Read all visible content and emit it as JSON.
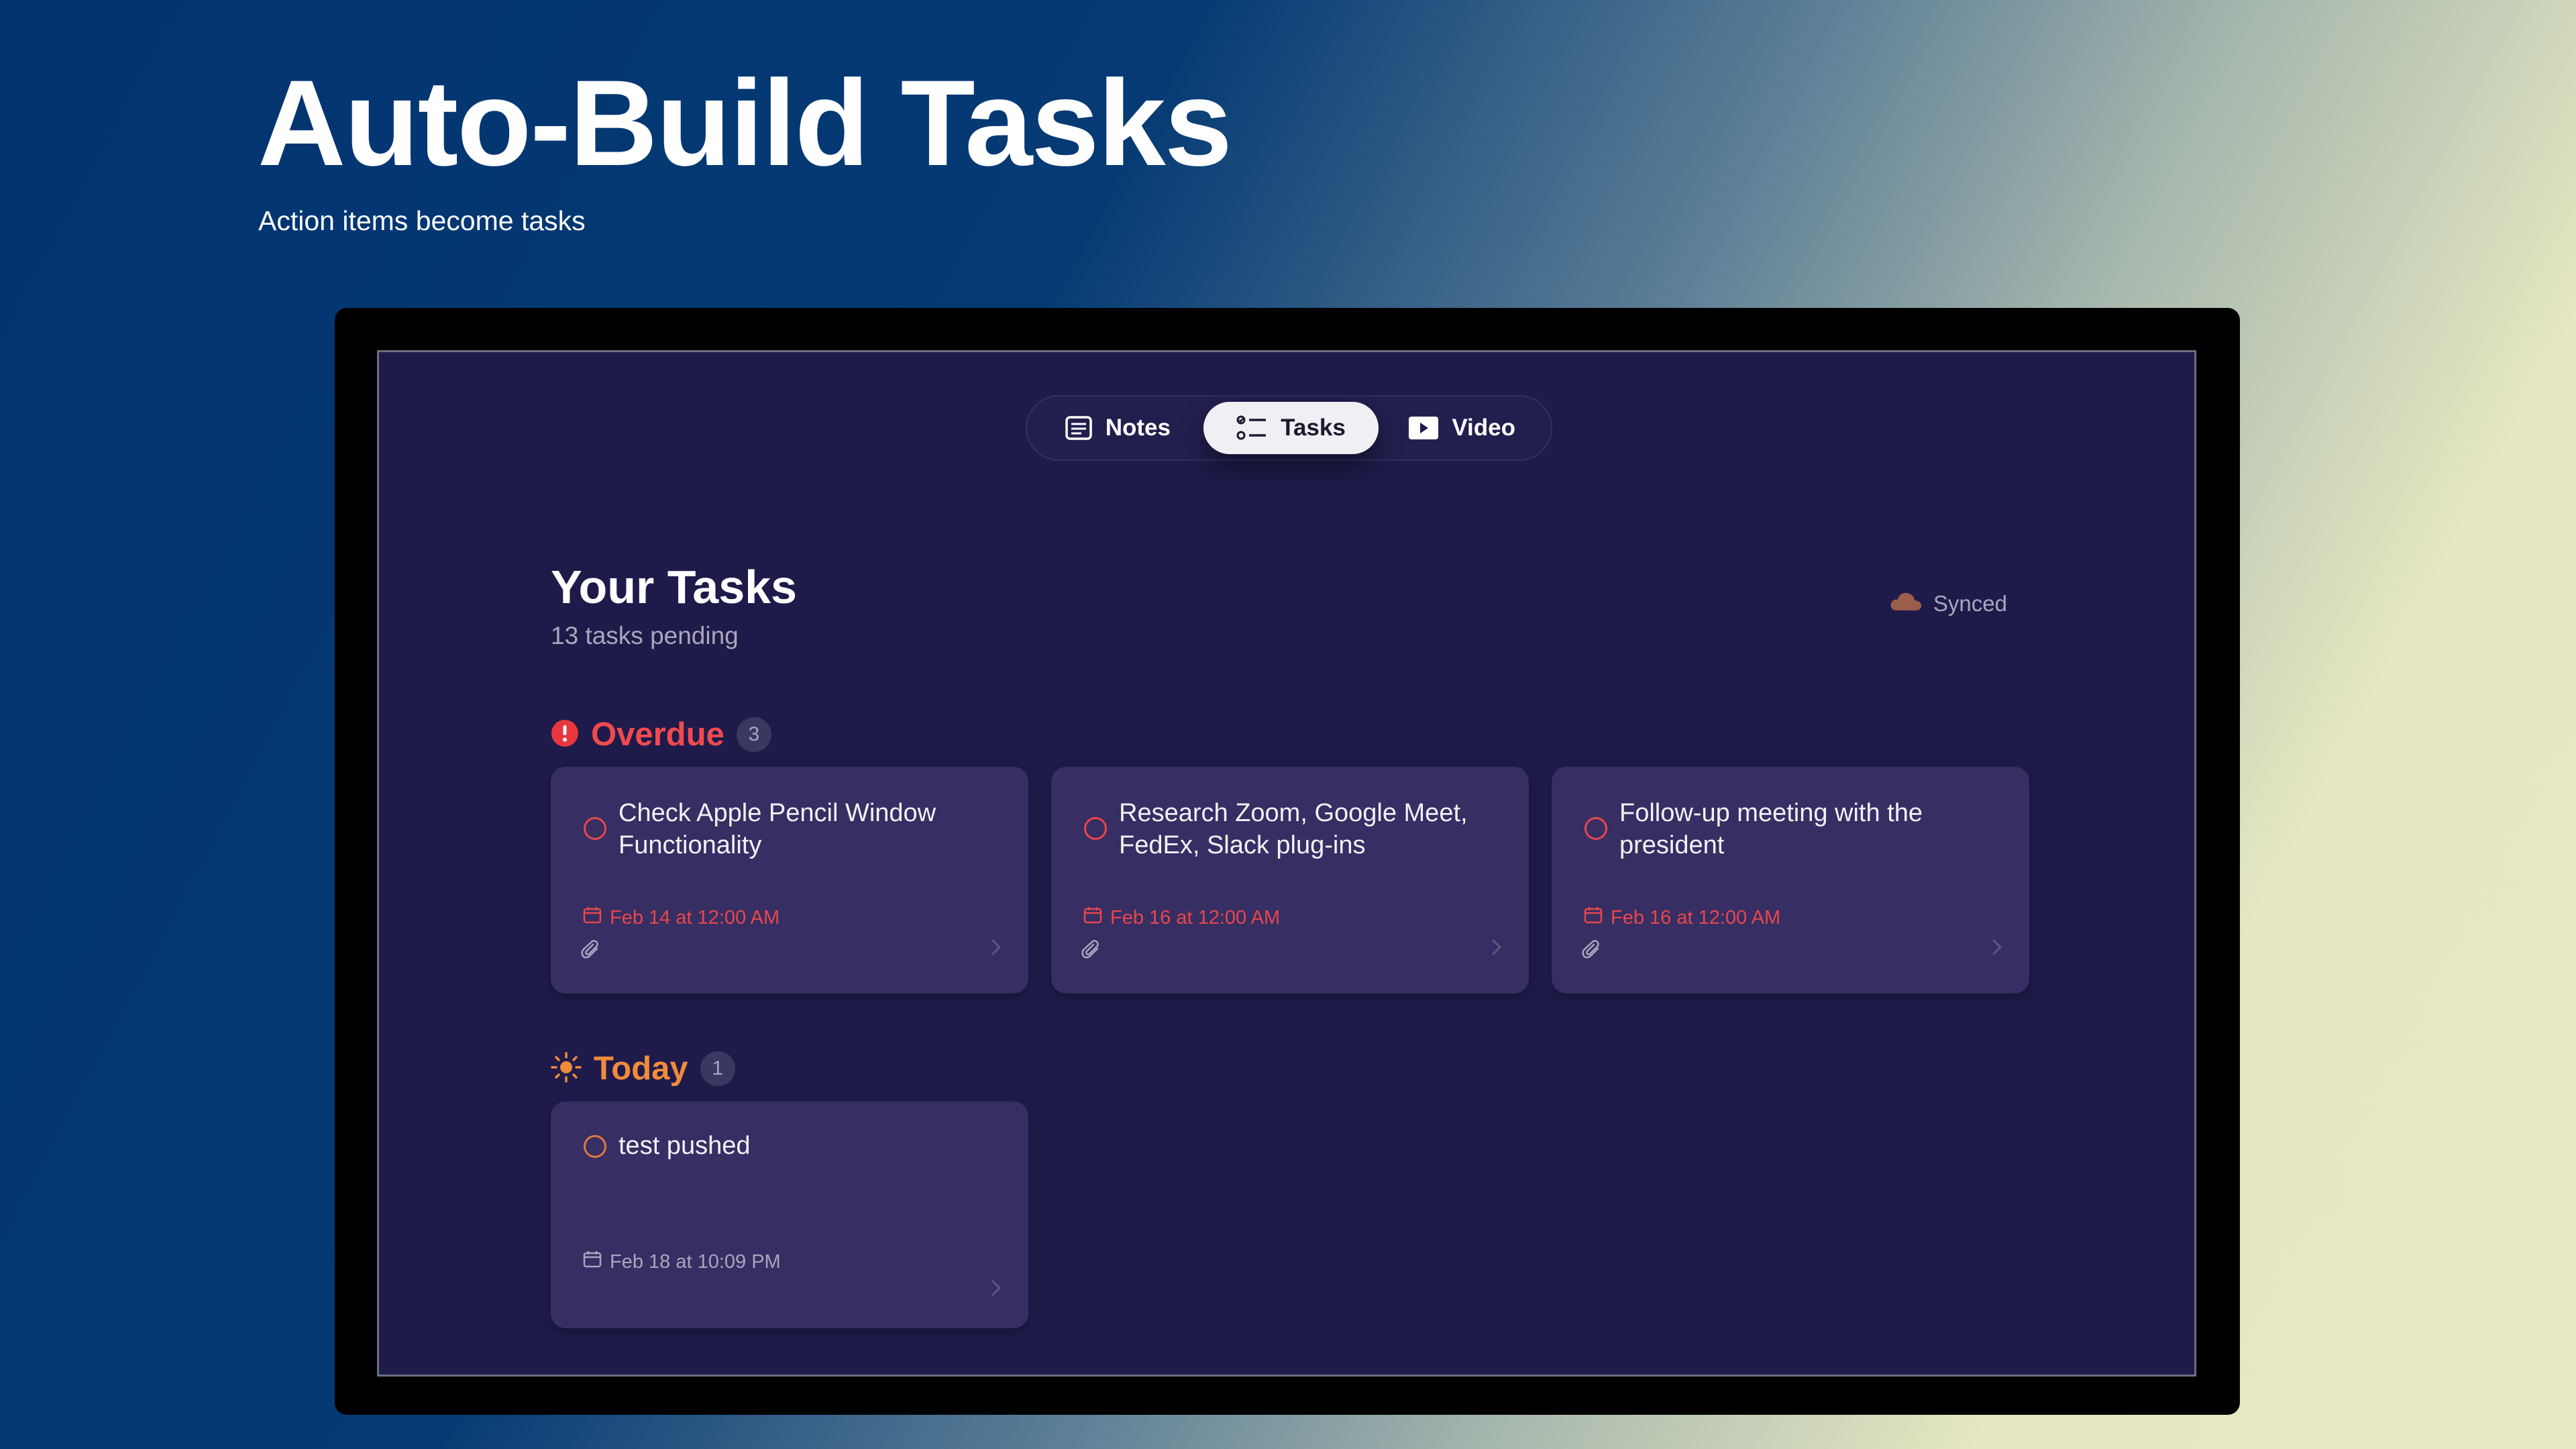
{
  "hero": {
    "title": "Auto-Build Tasks",
    "subtitle": "Action items become tasks"
  },
  "tabs": [
    {
      "label": "Notes",
      "icon": "notes-icon",
      "selected": false
    },
    {
      "label": "Tasks",
      "icon": "tasks-list-icon",
      "selected": true
    },
    {
      "label": "Video",
      "icon": "play-icon",
      "selected": false
    }
  ],
  "page": {
    "title": "Your Tasks",
    "pending": "13 tasks pending",
    "sync_status": "Synced",
    "sync_icon": "cloud-icon"
  },
  "sections": {
    "overdue": {
      "title": "Overdue",
      "count": "3",
      "icon": "alert-icon",
      "color": "#f04a4e",
      "tasks": [
        {
          "text": "Check Apple Pencil Window Functionality",
          "due": "Feb 14 at 12:00 AM",
          "has_attachment": true
        },
        {
          "text": "Research Zoom, Google Meet, FedEx, Slack plug-ins",
          "due": "Feb 16 at 12:00 AM",
          "has_attachment": true
        },
        {
          "text": "Follow-up meeting with the president",
          "due": "Feb 16 at 12:00 AM",
          "has_attachment": true
        }
      ]
    },
    "today": {
      "title": "Today",
      "count": "1",
      "icon": "sun-icon",
      "color": "#f08a3c",
      "tasks": [
        {
          "text": "test pushed",
          "due": "Feb 18 at 10:09 PM",
          "has_attachment": false
        }
      ]
    }
  },
  "colors": {
    "screen_bg": "#1e1b4a",
    "card_bg": "#372e63",
    "selected_tab_bg": "#f0eff4"
  }
}
